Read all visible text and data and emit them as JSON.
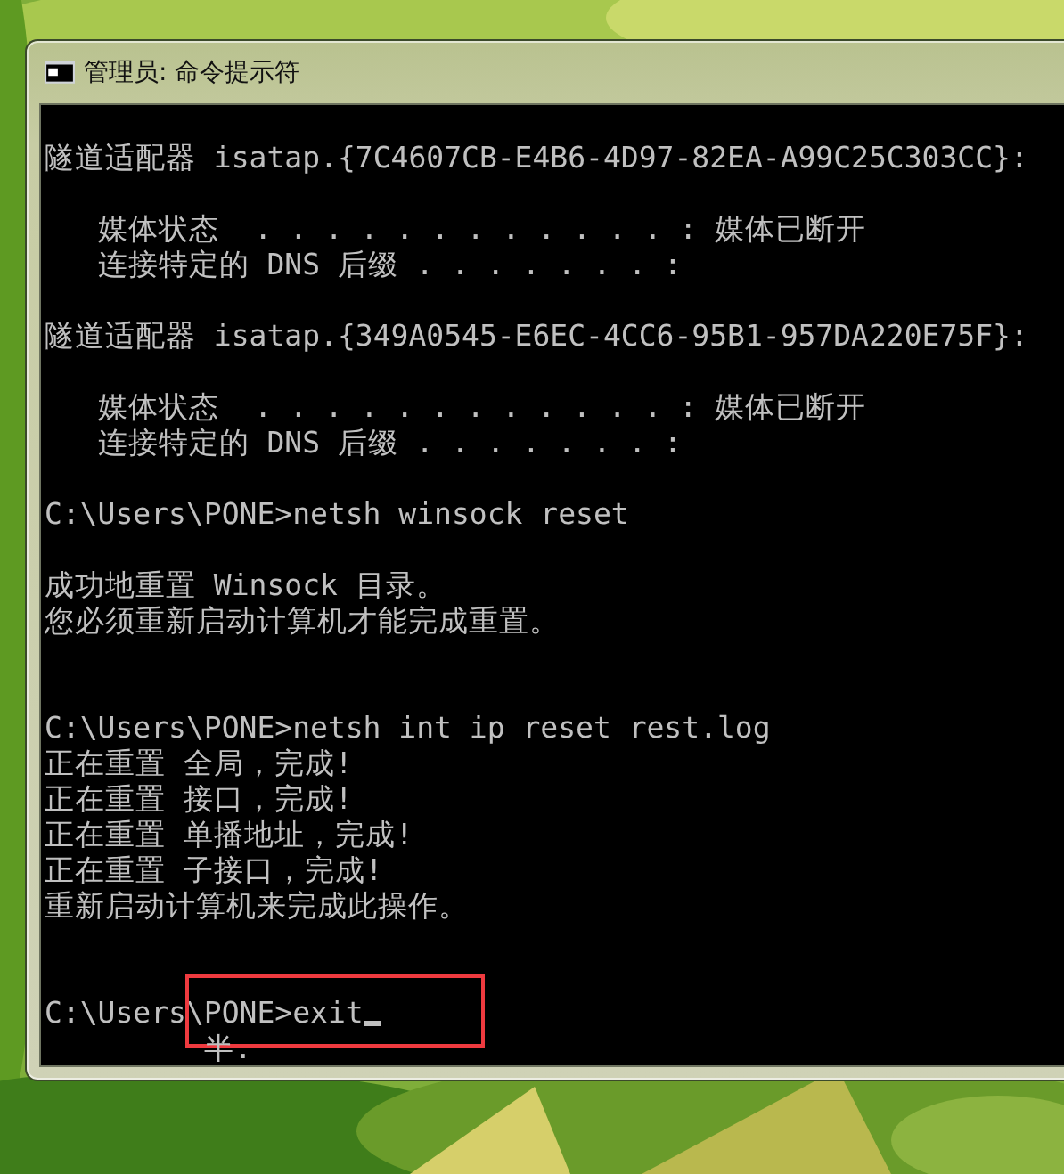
{
  "window": {
    "title": "管理员: 命令提示符"
  },
  "console": {
    "blocks": [
      {
        "kind": "heading",
        "lines": [
          {
            "text": "隧道适配器 isatap.{7C4607CB-E4B6-4D97-82EA-A99C25C303CC}:"
          }
        ]
      },
      {
        "kind": "details",
        "lines": [
          {
            "text": "   媒体状态  . . . . . . . . . . . . : 媒体已断开"
          },
          {
            "text": "   连接特定的 DNS 后缀 . . . . . . . :"
          }
        ]
      },
      {
        "kind": "heading",
        "lines": [
          {
            "text": "隧道适配器 isatap.{349A0545-E6EC-4CC6-95B1-957DA220E75F}:"
          }
        ]
      },
      {
        "kind": "details",
        "lines": [
          {
            "text": "   媒体状态  . . . . . . . . . . . . : 媒体已断开"
          },
          {
            "text": "   连接特定的 DNS 后缀 . . . . . . . :"
          }
        ]
      },
      {
        "kind": "command",
        "lines": [
          {
            "text": "C:\\Users\\PONE>netsh winsock reset"
          }
        ]
      },
      {
        "kind": "result",
        "lines": [
          {
            "text": "成功地重置 Winsock 目录。"
          },
          {
            "text": "您必须重新启动计算机才能完成重置。"
          }
        ]
      },
      {
        "kind": "command",
        "lines": [
          {
            "text": "C:\\Users\\PONE>netsh int ip reset rest.log"
          },
          {
            "text": "正在重置 全局，完成!"
          },
          {
            "text": "正在重置 接口，完成!"
          },
          {
            "text": "正在重置 单播地址，完成!"
          },
          {
            "text": "正在重置 子接口，完成!"
          },
          {
            "text": "重新启动计算机来完成此操作。"
          }
        ]
      },
      {
        "kind": "command",
        "lines": [
          {
            "text": "C:\\Users\\PONE>exit",
            "cursor": true,
            "highlighted": true
          },
          {
            "text": "         半."
          }
        ]
      }
    ]
  }
}
